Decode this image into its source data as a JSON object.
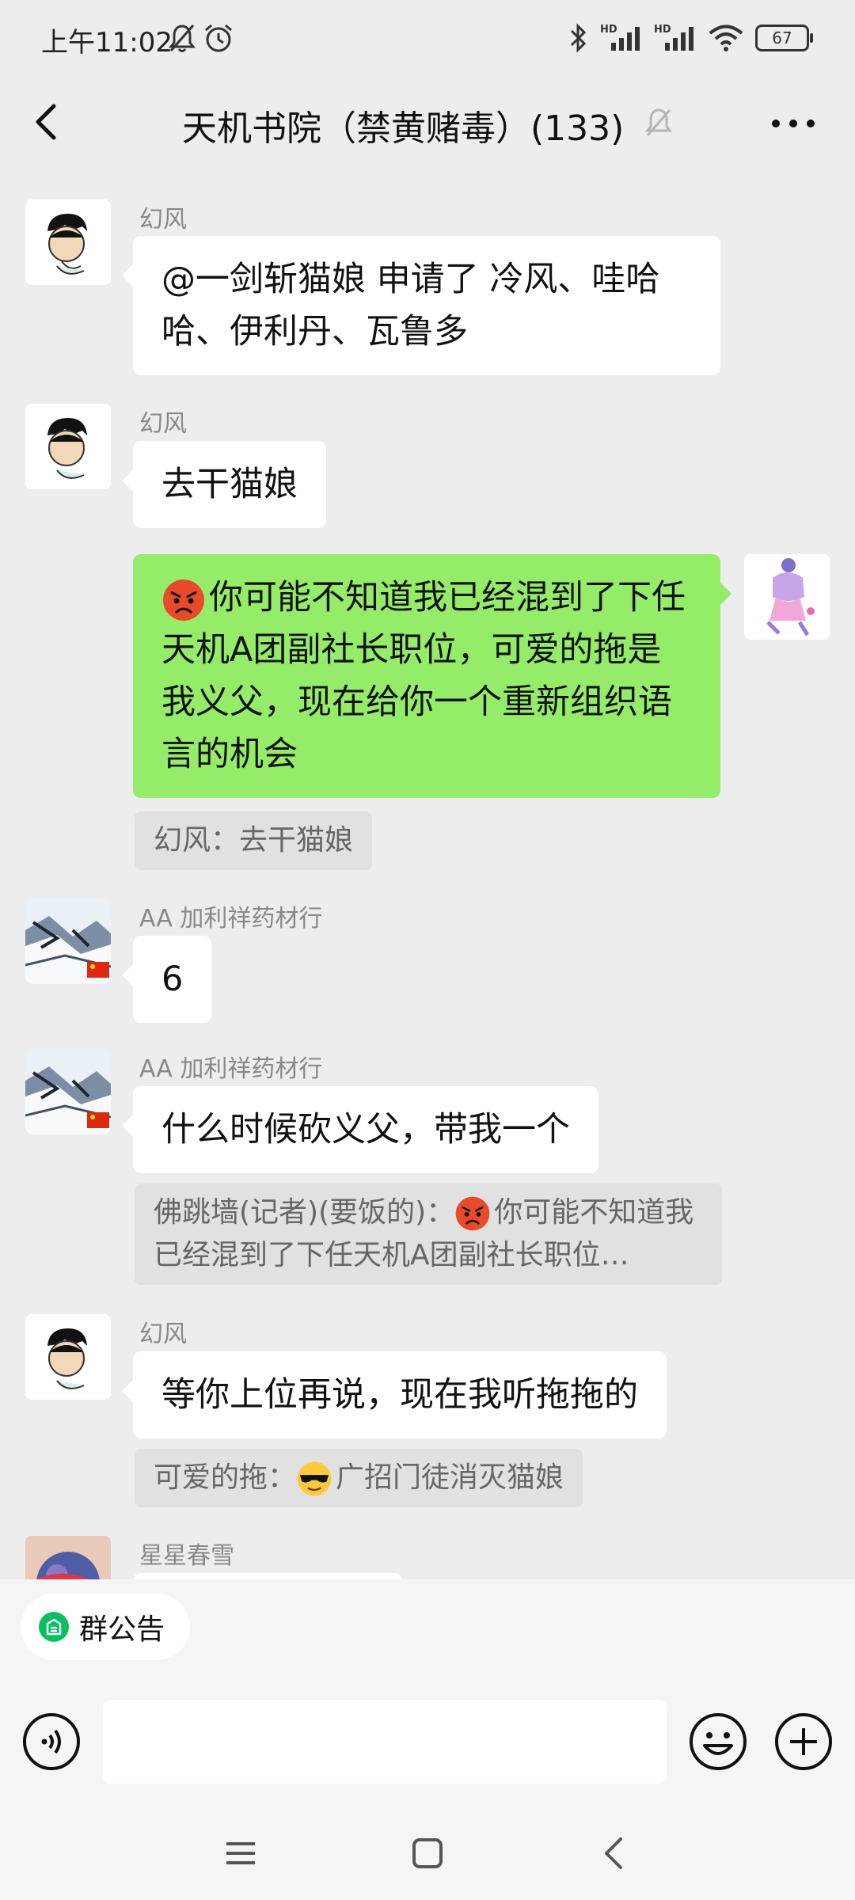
{
  "status_bar": {
    "time": "上午11:02",
    "battery": "67"
  },
  "header": {
    "title": "天机书院（禁黄赌毒）(133)"
  },
  "messages": [
    {
      "sender": "幻风",
      "text": "@一剑斩猫娘  申请了 冷风、哇哈哈、伊利丹、瓦鲁多"
    },
    {
      "sender": "幻风",
      "text": "去干猫娘"
    },
    {
      "text": "你可能不知道我已经混到了下任天机A团副社长职位，可爱的拖是我义父，现在给你一个重新组织语言的机会",
      "quote": "幻风：去干猫娘"
    },
    {
      "sender": "AA  加利祥药材行",
      "text": "6"
    },
    {
      "sender": "AA  加利祥药材行",
      "text": "什么时候砍义父，带我一个",
      "quote_prefix": "佛跳墙(记者)(要饭的)：",
      "quote": "你可能不知道我已经混到了下任天机A团副社长职位…"
    },
    {
      "sender": "幻风",
      "text": "等你上位再说，现在我听拖拖的",
      "quote_prefix": "可爱的拖：",
      "quote": "广招门徒消灭猫娘"
    },
    {
      "sender": "星星春雪"
    }
  ],
  "announcement": {
    "label": "群公告"
  },
  "input": {
    "placeholder": ""
  },
  "colors": {
    "background": "#ededed",
    "incoming_bubble": "#ffffff",
    "outgoing_bubble": "#95ec69",
    "quote_bg": "#e1e1e1",
    "announce_icon": "#07c160"
  }
}
